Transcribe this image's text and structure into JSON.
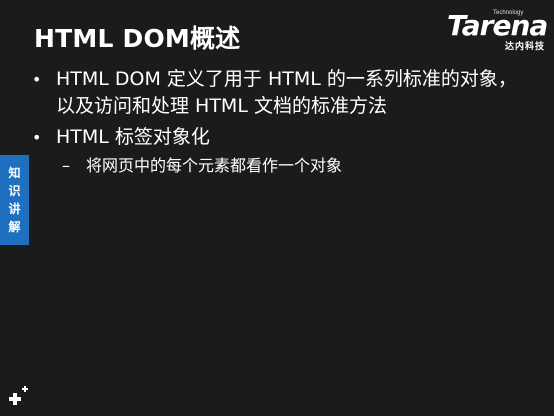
{
  "slide": {
    "title": "HTML DOM概述",
    "bullets": [
      {
        "text_line1": "HTML DOM 定义了用于 HTML 的一系列标准的对象，",
        "text_line2": "以及访问和处理 HTML 文档的标准方法"
      },
      {
        "text": "HTML 标签对象化",
        "sub": "将网页中的每个元素都看作一个对象"
      }
    ],
    "bullet_symbol": "•",
    "sub_symbol": "–"
  },
  "logo": {
    "main": "Tarena",
    "tagline": "Technology",
    "chinese": "达内科技"
  },
  "side_tab": {
    "chars": [
      "知",
      "识",
      "讲",
      "解"
    ],
    "color": "#1e6fc0"
  },
  "icons": {
    "corner": "plus-cluster-icon"
  },
  "colors": {
    "background": "#1b1b1b",
    "text": "#ffffff",
    "accent": "#1e6fc0"
  }
}
